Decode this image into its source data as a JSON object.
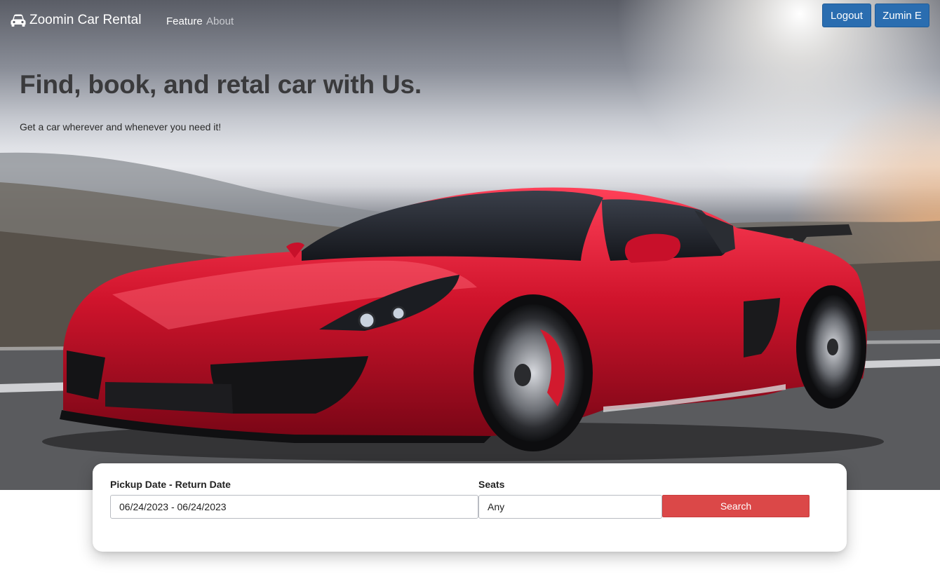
{
  "nav": {
    "brand": "Zoomin Car Rental",
    "brand_icon": "car-icon",
    "links": [
      {
        "label": "Feature",
        "active": true
      },
      {
        "label": "About",
        "active": false
      }
    ],
    "logout_label": "Logout",
    "user_label": "Zumin E"
  },
  "hero": {
    "title": "Find, book, and retal car with Us.",
    "subtitle": "Get a car wherever and whenever you need it!"
  },
  "search": {
    "dates_label": "Pickup Date - Return Date",
    "dates_value": "06/24/2023 - 06/24/2023",
    "seats_label": "Seats",
    "seats_value": "Any",
    "search_button": "Search"
  },
  "colors": {
    "primary": "#2a6db0",
    "danger": "#db4848",
    "car": "#d0142c"
  }
}
